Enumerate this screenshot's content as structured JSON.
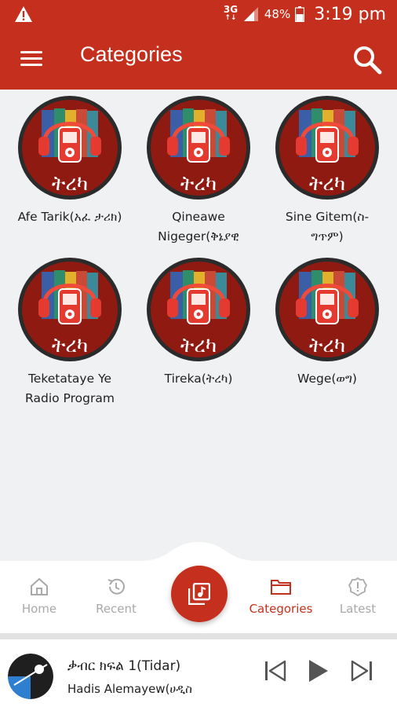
{
  "status_bar": {
    "network_top": "3G",
    "network_bottom": "↑↓",
    "battery": "48%",
    "time": "3:19 pm",
    "icons": [
      "warning-icon",
      "signal-icon",
      "battery-icon"
    ]
  },
  "app_bar": {
    "title": "Categories",
    "icons": [
      "menu-icon",
      "search-icon"
    ],
    "color": "#c4301d"
  },
  "categories": [
    {
      "label": "Afe Tarik(አፈ ታሪክ)"
    },
    {
      "label": "Qineawe Nigeger(ቅኔያዊ"
    },
    {
      "label": "Sine Gitem(ስ-ግጥም)"
    },
    {
      "label": "Teketataye Ye Radio Program"
    },
    {
      "label": "Tireka(ትረካ)"
    },
    {
      "label": "Wege(ወግ)"
    }
  ],
  "thumb_caption": "ትረካ",
  "bottom_nav": {
    "items": [
      {
        "label": "Home",
        "icon": "home-icon"
      },
      {
        "label": "Recent",
        "icon": "history-icon"
      },
      {
        "label": "Categories",
        "icon": "folder-icon",
        "active": true
      },
      {
        "label": "Latest",
        "icon": "alert-icon"
      }
    ],
    "fab_icon": "music-library-icon"
  },
  "player": {
    "title": "ቃብር  ክፍል 1(Tidar)",
    "artist": "Hadis Alemayew(ሀዲስ",
    "controls": [
      "skip-previous-icon",
      "play-icon",
      "skip-next-icon"
    ]
  },
  "colors": {
    "accent": "#c4301d",
    "inactive": "#a9a9a9",
    "background": "#eff1f3"
  }
}
